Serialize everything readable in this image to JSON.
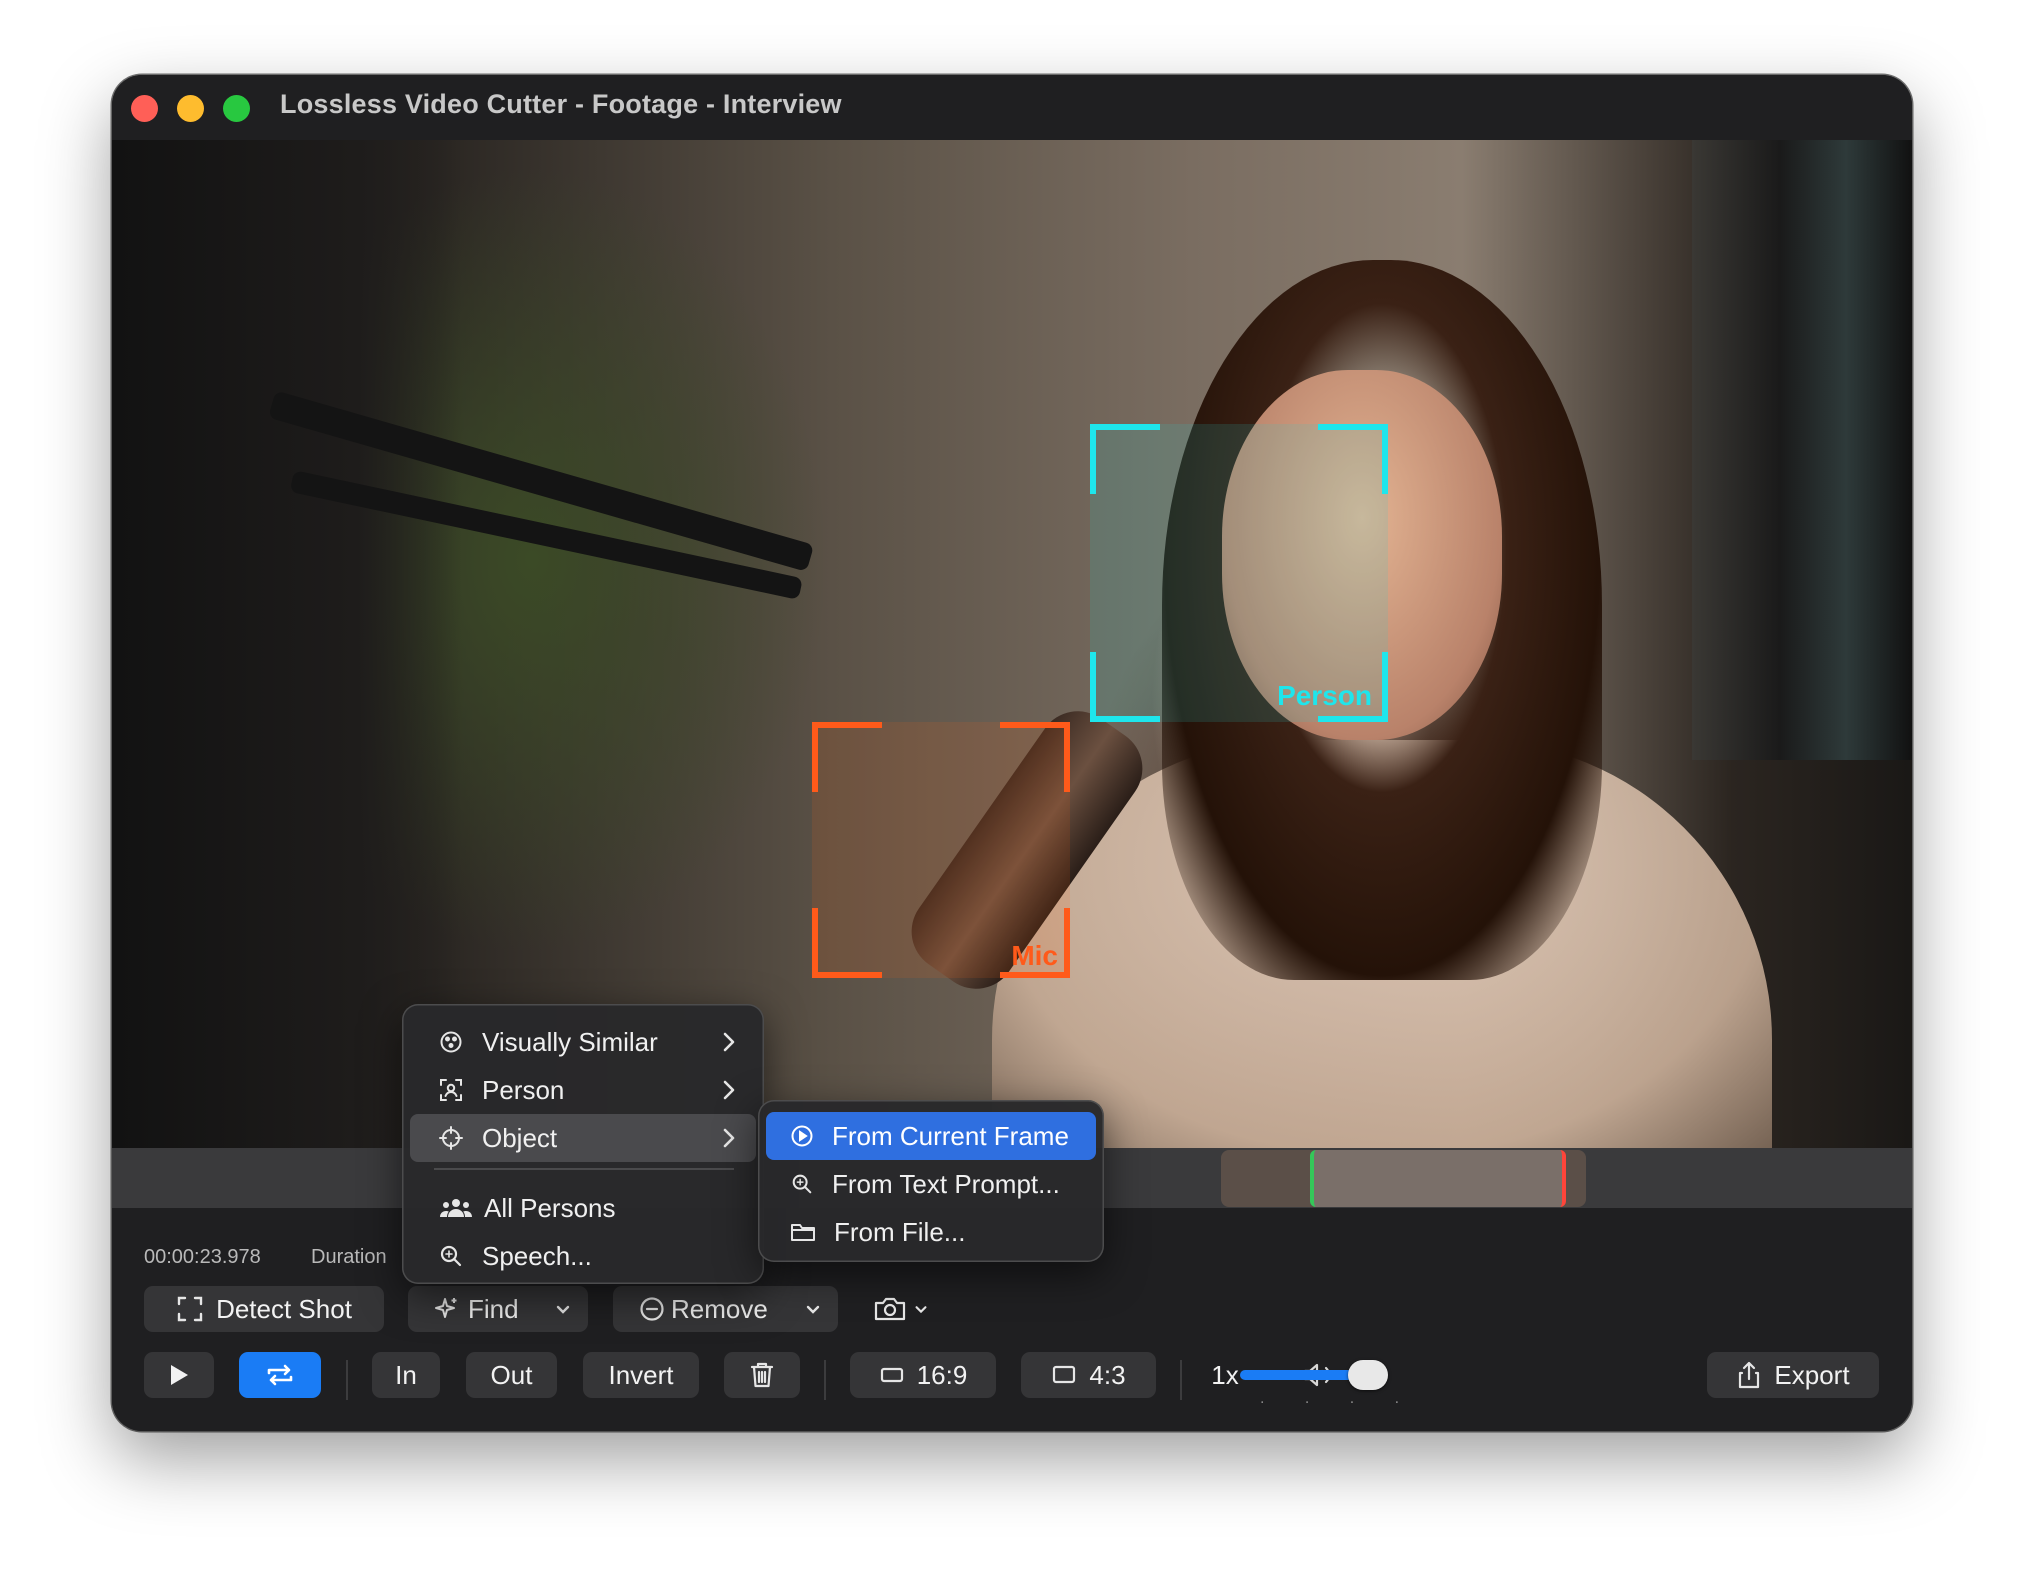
{
  "window": {
    "title": "Lossless Video Cutter - Footage - Interview"
  },
  "detections": [
    {
      "label": "Person",
      "color": "#1ee6ec"
    },
    {
      "label": "Mic",
      "color": "#ff5a1a"
    }
  ],
  "timeline": {
    "current_time": "00:00:23.978",
    "duration_label": "Duration"
  },
  "toolbar1": {
    "detect_shot": "Detect Shot",
    "find": "Find",
    "remove": "Remove"
  },
  "toolbar2": {
    "in": "In",
    "out": "Out",
    "invert": "Invert",
    "aspect_169": "16:9",
    "aspect_43": "4:3",
    "speed": "1x",
    "export": "Export"
  },
  "menu": {
    "items": [
      {
        "label": "Visually Similar",
        "icon": "visually-similar-icon"
      },
      {
        "label": "Person",
        "icon": "person-icon"
      },
      {
        "label": "Object",
        "icon": "crosshair-icon"
      },
      {
        "label": "All Persons",
        "icon": "people-icon"
      },
      {
        "label": "Speech...",
        "icon": "search-icon"
      }
    ],
    "submenu": [
      {
        "label": "From Current Frame",
        "icon": "play-circle-icon"
      },
      {
        "label": "From Text Prompt...",
        "icon": "search-icon"
      },
      {
        "label": "From File...",
        "icon": "folder-icon"
      }
    ]
  },
  "colors": {
    "accent": "#1a7cf5",
    "in_marker": "#34c759",
    "out_marker": "#ff453a"
  },
  "volume": 0.75
}
